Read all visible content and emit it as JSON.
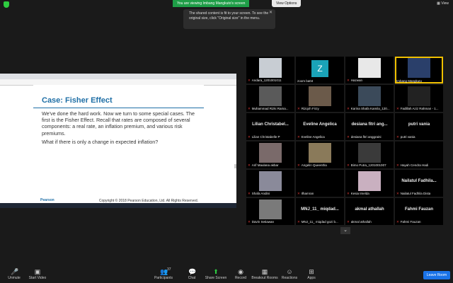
{
  "topbar": {
    "viewing_text": "You are viewing Imbang Mangkuto's screen",
    "view_options": "View Options",
    "view_button": "View"
  },
  "tooltip": {
    "text": "The shared content is fit to your screen. To see the original size, click \"Original size\" in the menu."
  },
  "slide": {
    "title": "Case: Fisher Effect",
    "paragraph1": "We've done the hard work. Now we turn to some special cases. The first is the Fisher Effect. Recall that rates are composed of several components: a real rate, an inflation premium, and various risk premiums.",
    "paragraph2": "What if there is only a change in expected inflation?",
    "brand": "Pearson",
    "copyright": "Copyright © 2018 Pearson Education, Ltd. All Rights Reserved."
  },
  "participants": [
    {
      "label": "Andara_1201001011",
      "big": "",
      "muted": true
    },
    {
      "label": "zoom ba04",
      "big": "",
      "muted": false,
      "avatar_letter": "Z"
    },
    {
      "label": "Hazwan",
      "big": "",
      "muted": true
    },
    {
      "label": "Imbang Mangkuto",
      "big": "",
      "muted": false,
      "active": true
    },
    {
      "label": "Muhammad Rizki Rama...",
      "big": "",
      "muted": true
    },
    {
      "label": "Rizqoh Firzy",
      "big": "",
      "muted": true
    },
    {
      "label": "Karina Shafa Kamila_120...",
      "big": "",
      "muted": true
    },
    {
      "label": "Fadillah Aziz Rahman - 1...",
      "big": "",
      "muted": true
    },
    {
      "label": "Lilian Christabelle P",
      "big": "Lilian Christabel...",
      "muted": true
    },
    {
      "label": "Eveline Angelica",
      "big": "Eveline Angelica",
      "muted": true
    },
    {
      "label": "desiana fitri anggraini",
      "big": "desiana fitri ang...",
      "muted": true
    },
    {
      "label": "putri vania",
      "big": "putri vania",
      "muted": true
    },
    {
      "label": "Arif Maulana akbar",
      "big": "",
      "muted": true
    },
    {
      "label": "Angelin Queentha",
      "big": "",
      "muted": true
    },
    {
      "label": "Bimo Putra_1201001007",
      "big": "",
      "muted": true
    },
    {
      "label": "Hayah Cendra Hadi",
      "big": "",
      "muted": true
    },
    {
      "label": "Shafa Andini",
      "big": "",
      "muted": true
    },
    {
      "label": "Ilhamran",
      "big": "",
      "muted": true
    },
    {
      "label": "Kesia Imelda",
      "big": "",
      "muted": true
    },
    {
      "label": "Nailatul Fadhila Dista",
      "big": "Nailatul Fadhila...",
      "muted": true
    },
    {
      "label": "Davin Setiawan",
      "big": "",
      "muted": true
    },
    {
      "label": "MNJ_11_ miqdad gozi b...",
      "big": "MNJ_11_ miqdad...",
      "muted": true
    },
    {
      "label": "akmal athallah",
      "big": "akmal athallah",
      "muted": true
    },
    {
      "label": "Fahmi Fauzan",
      "big": "Fahmi Fauzan",
      "muted": true
    }
  ],
  "toolbar": {
    "unmute": "Unmute",
    "start_video": "Start Video",
    "participants": "Participants",
    "participant_count": "37",
    "chat": "Chat",
    "share_screen": "Share Screen",
    "record": "Record",
    "breakout_rooms": "Breakout Rooms",
    "reactions": "Reactions",
    "apps": "Apps",
    "leave": "Leave Room"
  }
}
